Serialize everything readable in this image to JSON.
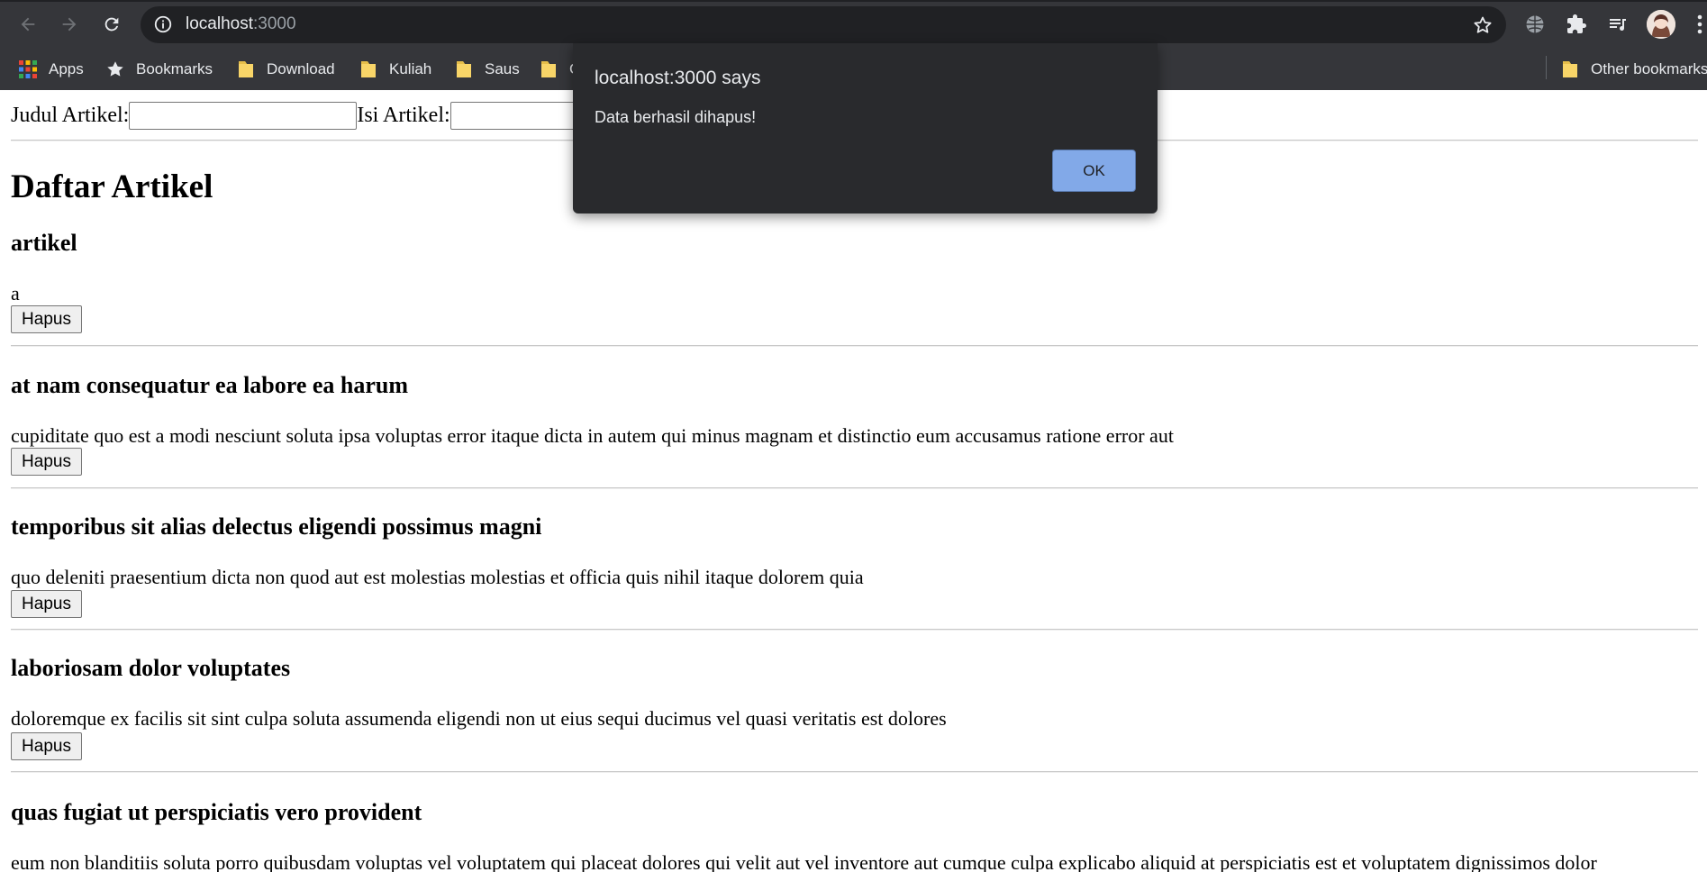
{
  "browser": {
    "url_host": "localhost",
    "url_port": ":3000",
    "bookmarks": [
      {
        "label": "Apps",
        "icon": "apps-grid-icon"
      },
      {
        "label": "Bookmarks",
        "icon": "star-icon"
      },
      {
        "label": "Download",
        "icon": "folder-icon"
      },
      {
        "label": "Kuliah",
        "icon": "folder-icon"
      },
      {
        "label": "Saus",
        "icon": "folder-icon"
      },
      {
        "label": "C",
        "icon": "folder-icon"
      }
    ],
    "other_bookmarks": "Other bookmarks",
    "colors": {
      "chrome": "#35363a",
      "omnibox": "#202124",
      "folder": "#f8d568"
    }
  },
  "form": {
    "judul_label": "Judul Artikel:",
    "isi_label": "Isi Artikel:"
  },
  "page_title": "Daftar Artikel",
  "delete_label": "Hapus",
  "articles": [
    {
      "title": "artikel",
      "body": "a"
    },
    {
      "title": "at nam consequatur ea labore ea harum",
      "body": "cupiditate quo est a modi nesciunt soluta ipsa voluptas error itaque dicta in autem qui minus magnam et distinctio eum accusamus ratione error aut"
    },
    {
      "title": "temporibus sit alias delectus eligendi possimus magni",
      "body": "quo deleniti praesentium dicta non quod aut est molestias molestias et officia quis nihil itaque dolorem quia"
    },
    {
      "title": "laboriosam dolor voluptates",
      "body": "doloremque ex facilis sit sint culpa soluta assumenda eligendi non ut eius sequi ducimus vel quasi veritatis est dolores"
    },
    {
      "title": "quas fugiat ut perspiciatis vero provident",
      "body": "eum non blanditiis soluta porro quibusdam voluptas vel voluptatem qui placeat dolores qui velit aut vel inventore aut cumque culpa explicabo aliquid at perspiciatis est et voluptatem dignissimos dolor"
    }
  ],
  "dialog": {
    "title": "localhost:3000 says",
    "message": "Data berhasil dihapus!",
    "ok_label": "OK",
    "ok_color": "#8ab4f8"
  }
}
